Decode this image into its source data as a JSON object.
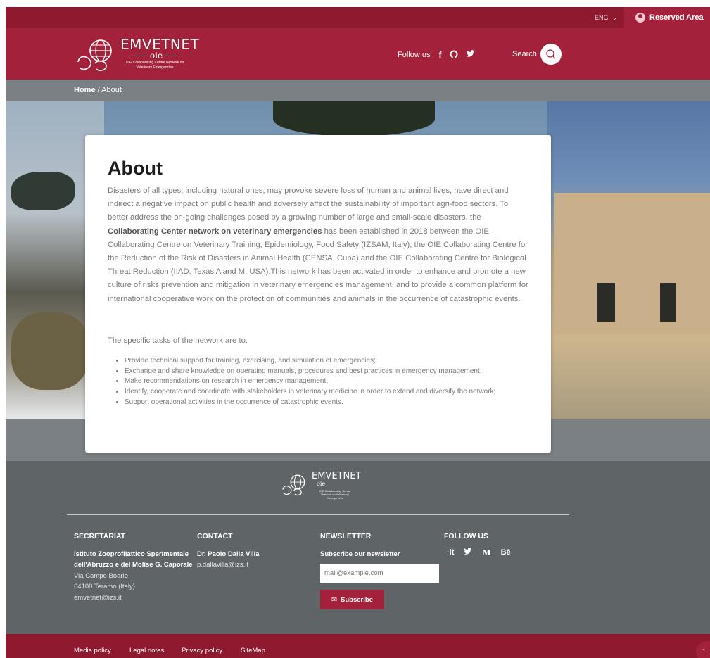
{
  "topbar": {
    "lang": "ENG",
    "reserved": "Reserved Area"
  },
  "header": {
    "logo_title": "EMVETNET",
    "logo_oie": "oie",
    "logo_sub": "OIE Collaborating Centre Network on Veterinary Emergencies",
    "follow_label": "Follow us",
    "search_label": "Search"
  },
  "breadcrumb": {
    "home": "Home",
    "sep": "/",
    "current": "About"
  },
  "about": {
    "title": "About",
    "intro_part1": "Disasters of all types, including natural ones, may provoke severe loss of human and animal lives, have direct and indirect a negative impact on public health and adversely affect the sustainability of important agri-food sectors. To better address the on-going challenges posed by a growing number of large and small-scale disasters, the ",
    "intro_bold": "Collaborating Center network on veterinary emergencies",
    "intro_part2": " has been established in 2018 between the OIE Collaborating Centre on Veterinary Training, Epidemiology, Food Safety (IZSAM, Italy), the OIE Collaborating Centre for the Reduction of the Risk of Disasters in Animal Health (CENSA, Cuba) and the OIE Collaborating Centre for Biological Threat Reduction (IIAD, Texas A and M, USA).This network has been activated in order to enhance and promote a new culture of risks prevention and mitigation in veterinary emergencies management, and to provide a common platform for international cooperative work on the protection of communities and animals in the occurrence of catastrophic events.",
    "tasks_title": "The specific tasks of the network are to:",
    "tasks": [
      "Provide technical support for training, exercising, and simulation of emergencies;",
      "Exchange and share knowledge on operating manuals, procedures and best practices in emergency management;",
      "Make recommendations on research in emergency management;",
      "Identify, cooperate and coordinate with stakeholders in veterinary medicine in order to extend and diversify the network;",
      "Support operational activities in the occurrence of catastrophic events."
    ]
  },
  "footer": {
    "secretariat": {
      "title": "SECRETARIAT",
      "org": "Istituto Zooprofilattico Sperimentale dell'Abruzzo e del Molise G. Caporale",
      "street": "Via Campo Boario",
      "city": "64100 Teramo (Italy)",
      "email": "emvetnet@izs.it"
    },
    "contact": {
      "title": "CONTACT",
      "name": "Dr. Paolo Dalla Villa",
      "email": "p.dallavilla@izs.it"
    },
    "newsletter": {
      "title": "NEWSLETTER",
      "subtitle": "Subscribe our newsletter",
      "placeholder": "mail@example.com",
      "button": "Subscribe"
    },
    "follow": {
      "title": "FOLLOW US",
      "icons": [
        "·lt",
        "🐦",
        "M",
        "Bē"
      ]
    },
    "links": [
      "Media policy",
      "Legal notes",
      "Privacy policy",
      "SiteMap"
    ]
  },
  "colors": {
    "brand": "#a3213a",
    "brand_dark": "#8f1a30",
    "footer": "#5f6467",
    "band": "#7b8085"
  }
}
